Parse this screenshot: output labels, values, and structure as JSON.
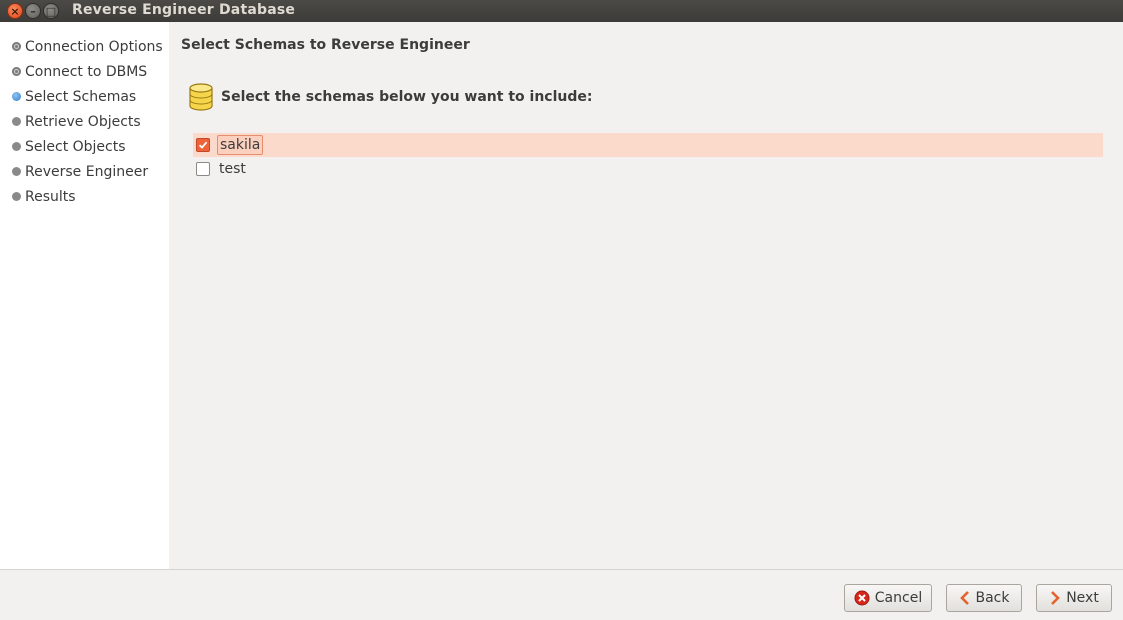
{
  "window": {
    "title": "Reverse Engineer Database",
    "buttons": {
      "close": "×",
      "minimize": "–",
      "maximize": "□"
    }
  },
  "sidebar": {
    "steps": [
      {
        "label": "Connection Options",
        "state": "done"
      },
      {
        "label": "Connect to DBMS",
        "state": "done"
      },
      {
        "label": "Select Schemas",
        "state": "active"
      },
      {
        "label": "Retrieve Objects",
        "state": "pending"
      },
      {
        "label": "Select Objects",
        "state": "pending"
      },
      {
        "label": "Reverse Engineer",
        "state": "pending"
      },
      {
        "label": "Results",
        "state": "pending"
      }
    ]
  },
  "main": {
    "heading": "Select Schemas to Reverse Engineer",
    "instruction": "Select the schemas below you want to include:",
    "icon": "database-icon",
    "schemas": [
      {
        "name": "sakila",
        "checked": true,
        "selected": true
      },
      {
        "name": "test",
        "checked": false,
        "selected": false
      }
    ]
  },
  "footer": {
    "cancel_label": "Cancel",
    "back_label": "Back",
    "next_label": "Next"
  },
  "colors": {
    "accent": "#f0623a",
    "selected_row": "#fbd9cb",
    "titlebar": "#3c3b37",
    "active_step": "#2d7fd0"
  }
}
